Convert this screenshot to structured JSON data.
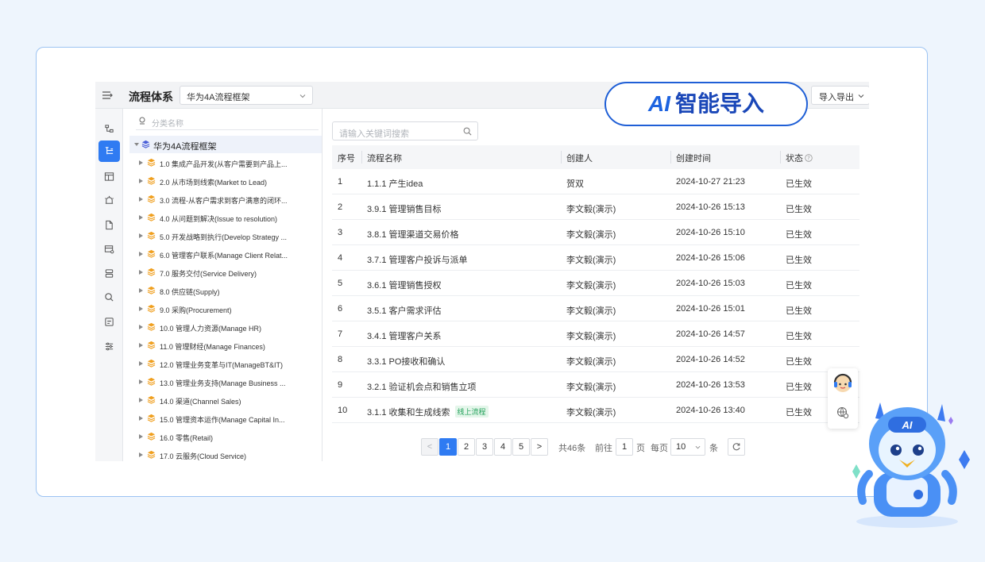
{
  "banner": {
    "ai_tag": "AI",
    "text": "智能导入"
  },
  "topbar": {
    "title": "流程体系",
    "framework": "华为4A流程框架",
    "io_button": "导入导出"
  },
  "tree": {
    "search_placeholder": "分类名称",
    "root": "华为4A流程框架",
    "items": [
      "1.0 集成产品开发(从客户需要到产品上...",
      "2.0 从市场到线索(Market to Lead)",
      "3.0 流程-从客户需求到客户满意的闭环...",
      "4.0 从问题到解决(Issue to resolution)",
      "5.0 开发战略到执行(Develop Strategy ...",
      "6.0 管理客户联系(Manage Client Relat...",
      "7.0 服务交付(Service Delivery)",
      "8.0 供应链(Supply)",
      "9.0 采购(Procurement)",
      "10.0 管理人力资源(Manage HR)",
      "11.0 管理财经(Manage Finances)",
      "12.0 管理业务变革与IT(ManageBT&IT)",
      "13.0 管理业务支持(Manage Business ...",
      "14.0 渠道(Channel Sales)",
      "15.0 管理资本运作(Manage Capital In...",
      "16.0 零售(Retail)",
      "17.0 云服务(Cloud Service)"
    ]
  },
  "search": {
    "placeholder": "请输入关键词搜索"
  },
  "table": {
    "headers": {
      "no": "序号",
      "name": "流程名称",
      "creator": "创建人",
      "time": "创建时间",
      "status": "状态"
    },
    "rows": [
      {
        "no": "1",
        "name": "1.1.1 产生idea",
        "creator": "贺双",
        "time": "2024-10-27 21:23",
        "status": "已生效",
        "tag": ""
      },
      {
        "no": "2",
        "name": "3.9.1 管理销售目标",
        "creator": "李文毅(演示)",
        "time": "2024-10-26 15:13",
        "status": "已生效",
        "tag": ""
      },
      {
        "no": "3",
        "name": "3.8.1 管理渠道交易价格",
        "creator": "李文毅(演示)",
        "time": "2024-10-26 15:10",
        "status": "已生效",
        "tag": ""
      },
      {
        "no": "4",
        "name": "3.7.1 管理客户投诉与派单",
        "creator": "李文毅(演示)",
        "time": "2024-10-26 15:06",
        "status": "已生效",
        "tag": ""
      },
      {
        "no": "5",
        "name": "3.6.1 管理销售授权",
        "creator": "李文毅(演示)",
        "time": "2024-10-26 15:03",
        "status": "已生效",
        "tag": ""
      },
      {
        "no": "6",
        "name": "3.5.1 客户需求评估",
        "creator": "李文毅(演示)",
        "time": "2024-10-26 15:01",
        "status": "已生效",
        "tag": ""
      },
      {
        "no": "7",
        "name": "3.4.1 管理客户关系",
        "creator": "李文毅(演示)",
        "time": "2024-10-26 14:57",
        "status": "已生效",
        "tag": ""
      },
      {
        "no": "8",
        "name": "3.3.1 PO接收和确认",
        "creator": "李文毅(演示)",
        "time": "2024-10-26 14:52",
        "status": "已生效",
        "tag": ""
      },
      {
        "no": "9",
        "name": "3.2.1 验证机会点和销售立项",
        "creator": "李文毅(演示)",
        "time": "2024-10-26 13:53",
        "status": "已生效",
        "tag": ""
      },
      {
        "no": "10",
        "name": "3.1.1 收集和生成线索",
        "creator": "李文毅(演示)",
        "time": "2024-10-26 13:40",
        "status": "已生效",
        "tag": "线上流程"
      }
    ]
  },
  "pagination": {
    "prev": "<",
    "next": ">",
    "pages": [
      "1",
      "2",
      "3",
      "4",
      "5"
    ],
    "current": "1",
    "total": "共46条",
    "goto_label": "前往",
    "goto_value": "1",
    "page_unit": "页",
    "per_page_label": "每页",
    "per_page": "10",
    "per_page_unit": "条"
  },
  "colors": {
    "accent": "#2f7bf2",
    "banner_text": "#1a47b8",
    "tag_green": "#22a05a",
    "stack_icon": "#f0a020"
  }
}
